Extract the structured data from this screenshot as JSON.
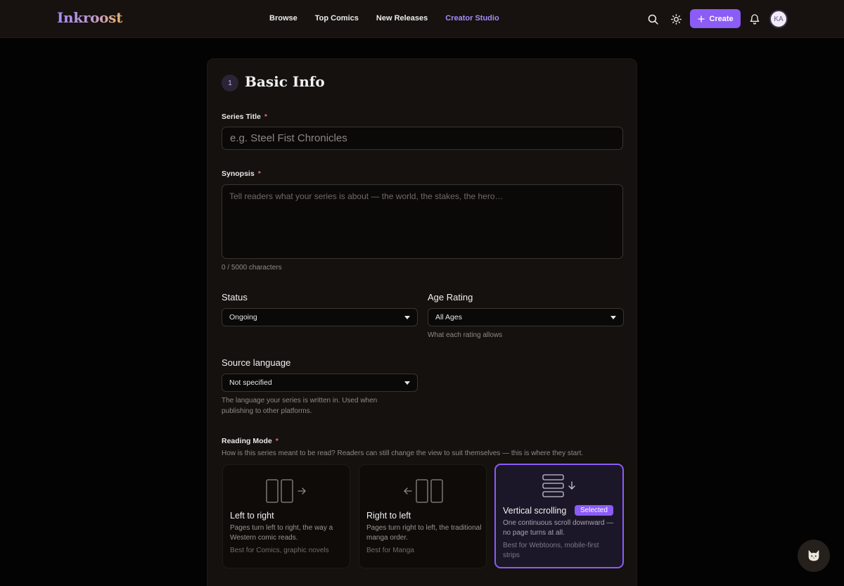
{
  "header": {
    "logo": "Inkroost",
    "nav": [
      "Browse",
      "Top Comics",
      "New Releases",
      "Creator Studio"
    ],
    "active_nav": "Creator Studio",
    "create_label": "Create",
    "avatar_initials": "KA",
    "icons": [
      "search-icon",
      "sun-icon",
      "plus-icon",
      "bell-icon"
    ]
  },
  "form": {
    "step_number": "1",
    "section_title": "Basic Info",
    "required_mark": "*",
    "series_title": {
      "label": "Series Title",
      "placeholder": "e.g. Steel Fist Chronicles",
      "value": ""
    },
    "synopsis": {
      "label": "Synopsis",
      "placeholder": "Tell readers what your series is about — the world, the stakes, the hero…",
      "value": "",
      "counter": "0 / 5000 characters"
    },
    "status": {
      "label": "Status",
      "value": "Ongoing"
    },
    "age_rating": {
      "label": "Age Rating",
      "value": "All Ages",
      "help_link": "What each rating allows"
    },
    "source_language": {
      "label": "Source language",
      "value": "Not specified",
      "hint": "The language your series is written in. Used when publishing to other platforms."
    },
    "reading_mode": {
      "label": "Reading Mode",
      "hint": "How is this series meant to be read? Readers can still change the view to suit themselves — this is where they start.",
      "selected_badge": "Selected",
      "options": [
        {
          "title": "Left to right",
          "description": "Pages turn left to right, the way a Western comic reads.",
          "best_for": "Best for Comics, graphic novels"
        },
        {
          "title": "Right to left",
          "description": "Pages turn right to left, the traditional manga order.",
          "best_for": "Best for Manga"
        },
        {
          "title": "Vertical scrolling",
          "description": "One continuous scroll downward — no page turns at all.",
          "best_for": "Best for Webtoons, mobile-first strips"
        }
      ]
    }
  },
  "colors": {
    "accent": "#8b5cf6",
    "background": "#030303",
    "card": "#15110e",
    "required": "#e06b8f"
  }
}
